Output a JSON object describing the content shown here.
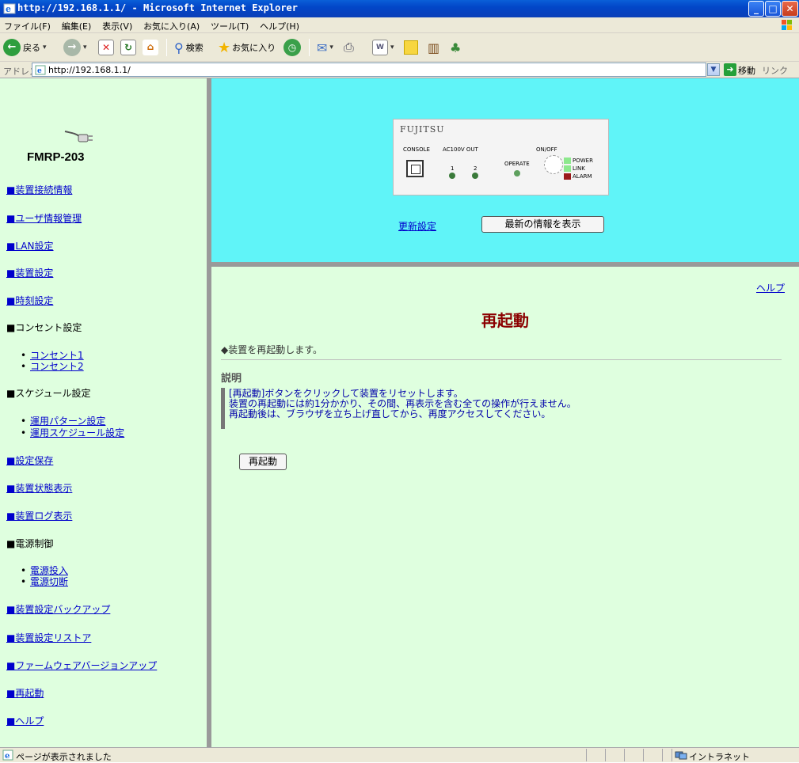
{
  "window": {
    "title": "http://192.168.1.1/ - Microsoft Internet Explorer"
  },
  "menu": [
    "ファイル(F)",
    "編集(E)",
    "表示(V)",
    "お気に入り(A)",
    "ツール(T)",
    "ヘルプ(H)"
  ],
  "toolbar": {
    "back_label": "戻る",
    "search_label": "検索",
    "favorites_label": "お気に入り"
  },
  "address": {
    "label": "アドレス(D)",
    "url": "http://192.168.1.1/",
    "go_label": "移動",
    "links_label": "リンク"
  },
  "sidebar": {
    "model": "FMRP-203",
    "items": [
      {
        "label": "■装置接続情報",
        "link": true
      },
      {
        "label": "■ユーザ情報管理",
        "link": true
      },
      {
        "label": "■LAN設定",
        "link": true
      },
      {
        "label": "■装置設定",
        "link": true
      },
      {
        "label": "■時刻設定",
        "link": true
      },
      {
        "label": "■コンセント設定",
        "link": false
      },
      {
        "label": "■スケジュール設定",
        "link": false
      },
      {
        "label": "■設定保存",
        "link": true
      },
      {
        "label": "■装置状態表示",
        "link": true
      },
      {
        "label": "■装置ログ表示",
        "link": true
      },
      {
        "label": "■電源制御",
        "link": false
      },
      {
        "label": "■装置設定バックアップ",
        "link": true
      },
      {
        "label": "■装置設定リストア",
        "link": true
      },
      {
        "label": "■ファームウェアバージョンアップ",
        "link": true
      },
      {
        "label": "■再起動",
        "link": true
      },
      {
        "label": "■ヘルプ",
        "link": true
      }
    ],
    "outlet_sub": [
      "コンセント1",
      "コンセント2"
    ],
    "schedule_sub": [
      "運用パターン設定",
      "運用スケジュール設定"
    ],
    "power_sub": [
      "電源投入",
      "電源切断"
    ]
  },
  "panel": {
    "brand": "FUJITSU",
    "console": "CONSOLE",
    "ac_out": "AC100V OUT",
    "on_off": "ON/OFF",
    "out1": "1",
    "out2": "2",
    "operate": "OPERATE",
    "power": "POWER",
    "link": "LINK",
    "alarm": "ALARM"
  },
  "top": {
    "update_link": "更新設定",
    "refresh_button": "最新の情報を表示"
  },
  "main": {
    "help_link": "ヘルプ",
    "title": "再起動",
    "intro": "◆装置を再起動します。",
    "desc_heading": "説明",
    "desc_lines": [
      "[再起動]ボタンをクリックして装置をリセットします。",
      "装置の再起動には約1分かかり、その間、再表示を含む全ての操作が行えません。",
      "再起動後は、ブラウザを立ち上げ直してから、再度アクセスしてください。"
    ],
    "reboot_button": "再起動"
  },
  "status": {
    "text": "ページが表示されました",
    "zone": "イントラネット"
  },
  "colors": {
    "sidebar_bg": "#dfffdf",
    "top_bg": "#60f4f8",
    "title_color": "#8b0000",
    "link_color": "#0000cc"
  }
}
